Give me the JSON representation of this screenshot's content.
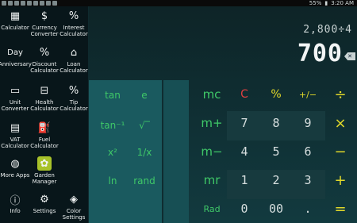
{
  "status": {
    "time": "3:20 AM",
    "battery": "55%"
  },
  "display": {
    "expression": "2,800÷4",
    "result": "700"
  },
  "drawer": [
    {
      "label": "Calculator",
      "icon": "calculator-grid-icon"
    },
    {
      "label": "Currency Converter",
      "icon": "dollar-icon"
    },
    {
      "label": "Interest Calculator",
      "icon": "percent-chart-icon"
    },
    {
      "label": "Anniversary",
      "icon": "day-icon",
      "icon_text": "Day"
    },
    {
      "label": "Discount Calculator",
      "icon": "discount-tag-icon"
    },
    {
      "label": "Loan Calculator",
      "icon": "loan-icon"
    },
    {
      "label": "Unit Converter",
      "icon": "ruler-icon"
    },
    {
      "label": "Health Calculator",
      "icon": "scale-icon"
    },
    {
      "label": "Tip Calculator",
      "icon": "tip-icon"
    },
    {
      "label": "VAT Calculator",
      "icon": "vat-icon"
    },
    {
      "label": "Fuel Calculator",
      "icon": "fuel-pump-icon"
    },
    {
      "label": "More Apps",
      "icon": "bag-icon"
    },
    {
      "label": "Garden Manager",
      "icon": "garden-icon"
    },
    {
      "label": "Info",
      "icon": "info-icon"
    },
    {
      "label": "Settings",
      "icon": "gear-icon"
    },
    {
      "label": "Color Settings",
      "icon": "paint-bucket-icon"
    }
  ],
  "sci_keys": [
    "tan",
    "e",
    "tan⁻¹",
    "√‾",
    "x²",
    "1/x",
    "ln",
    "rand"
  ],
  "memory_keys": [
    "mc",
    "m+",
    "m−",
    "mr",
    "Rad"
  ],
  "top_row": [
    "C",
    "%",
    "+/−",
    "÷"
  ],
  "digits": [
    [
      "7",
      "8",
      "9",
      "×"
    ],
    [
      "4",
      "5",
      "6",
      "−"
    ],
    [
      "1",
      "2",
      "3",
      "+"
    ],
    [
      "0",
      "00",
      ".",
      "="
    ]
  ],
  "colors": {
    "accent_green": "#3fc868",
    "accent_yellow": "#e2d92a",
    "clear_red": "#e04040",
    "sci_panel": "#1a5a5f"
  }
}
